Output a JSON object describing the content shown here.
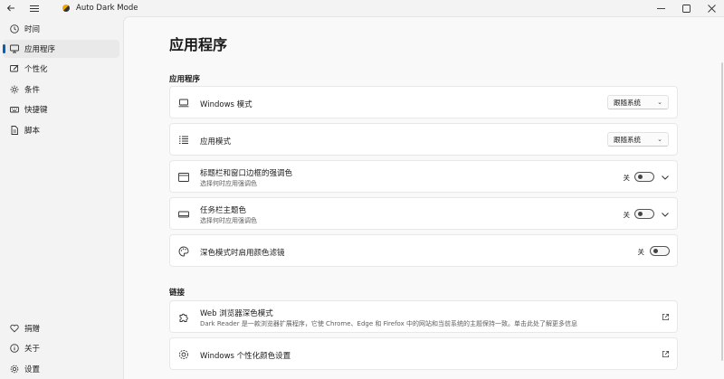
{
  "titlebar": {
    "app_title": "Auto Dark Mode",
    "back_icon": "back-arrow-icon",
    "menu_icon": "hamburger-menu-icon",
    "controls": [
      "minimize-icon",
      "maximize-icon",
      "close-icon"
    ]
  },
  "sidebar": {
    "items": [
      {
        "label": "时间",
        "icon": "clock-icon"
      },
      {
        "label": "应用程序",
        "icon": "monitor-icon",
        "active": true
      },
      {
        "label": "个性化",
        "icon": "personalize-brush-icon"
      },
      {
        "label": "条件",
        "icon": "gear-conditions-icon"
      },
      {
        "label": "快捷键",
        "icon": "keyboard-icon"
      },
      {
        "label": "脚本",
        "icon": "script-document-icon"
      }
    ],
    "footer_items": [
      {
        "label": "捐赠",
        "icon": "heart-icon"
      },
      {
        "label": "关于",
        "icon": "info-icon"
      },
      {
        "label": "设置",
        "icon": "settings-gear-icon"
      }
    ]
  },
  "page": {
    "title": "应用程序",
    "sections": {
      "apps": {
        "header": "应用程序",
        "windows_mode": {
          "title": "Windows 模式",
          "value": "跟随系统",
          "icon": "laptop-icon"
        },
        "app_mode": {
          "title": "应用模式",
          "value": "跟随系统",
          "icon": "list-icon"
        },
        "titlebar_accent": {
          "title": "标题栏和窗口边框的强调色",
          "subtitle": "选择何时应用强调色",
          "toggle_label": "关",
          "icon": "window-icon"
        },
        "taskbar_color": {
          "title": "任务栏主题色",
          "subtitle": "选择何时应用强调色",
          "toggle_label": "关",
          "icon": "taskbar-icon"
        },
        "color_filter": {
          "title": "深色模式时启用颜色滤镜",
          "toggle_label": "关",
          "icon": "palette-icon"
        }
      },
      "links": {
        "header": "链接",
        "dark_reader": {
          "title": "Web 浏览器深色模式",
          "subtitle": "Dark Reader 是一款浏览器扩展程序，它使 Chrome、Edge 和 Firefox 中的网站和当前系统的主题保持一致。单击此处了解更多信息",
          "icon": "puzzle-extension-icon"
        },
        "win_personalize": {
          "title": "Windows 个性化颜色设置",
          "icon": "settings-gear-icon"
        }
      }
    }
  },
  "colors": {
    "accent": "#005fb8",
    "background": "#f3f3f3",
    "card": "#ffffff"
  }
}
